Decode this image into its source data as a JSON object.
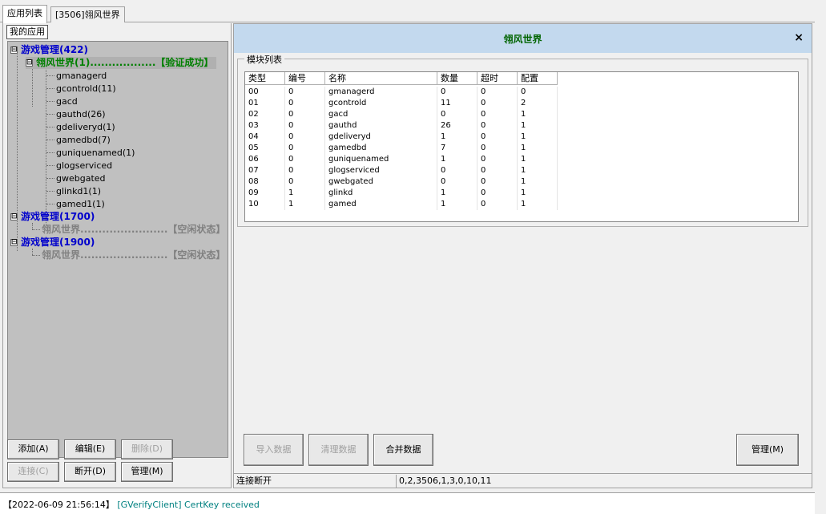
{
  "top_tabs": [
    "应用列表",
    "[3506]翎风世界"
  ],
  "left": {
    "subtab": "我的应用",
    "tree": {
      "group1": {
        "label": "游戏管理(422)",
        "expander": "⊟"
      },
      "game1": {
        "name": "翎风世界(1)",
        "dots": "..................",
        "status": "【验证成功】"
      },
      "modules": [
        "gmanagerd",
        "gcontrold(11)",
        "gacd",
        "gauthd(26)",
        "gdeliveryd(1)",
        "gamedbd(7)",
        "guniquenamed(1)",
        "glogserviced",
        "gwebgated",
        "glinkd1(1)",
        "gamed1(1)"
      ],
      "group2": {
        "label": "游戏管理(1700)",
        "expander": "⊟"
      },
      "game2": {
        "name": "翎风世界",
        "dots": "........................",
        "status": "【空闲状态】"
      },
      "group3": {
        "label": "游戏管理(1900)",
        "expander": "⊟"
      },
      "game3": {
        "name": "翎风世界",
        "dots": "........................",
        "status": "【空闲状态】"
      }
    },
    "buttons": {
      "add": "添加(A)",
      "edit": "编辑(E)",
      "delete": "删除(D)",
      "connect": "连接(C)",
      "disconnect": "断开(D)",
      "manage": "管理(M)"
    }
  },
  "right": {
    "title": "翎风世界",
    "close": "×",
    "groupbox_label": "模块列表",
    "columns": [
      "类型",
      "编号",
      "名称",
      "数量",
      "超时",
      "配置"
    ],
    "rows": [
      [
        "00",
        "0",
        "gmanagerd",
        "0",
        "0",
        "0"
      ],
      [
        "01",
        "0",
        "gcontrold",
        "11",
        "0",
        "2"
      ],
      [
        "02",
        "0",
        "gacd",
        "0",
        "0",
        "1"
      ],
      [
        "03",
        "0",
        "gauthd",
        "26",
        "0",
        "1"
      ],
      [
        "04",
        "0",
        "gdeliveryd",
        "1",
        "0",
        "1"
      ],
      [
        "05",
        "0",
        "gamedbd",
        "7",
        "0",
        "1"
      ],
      [
        "06",
        "0",
        "guniquenamed",
        "1",
        "0",
        "1"
      ],
      [
        "07",
        "0",
        "glogserviced",
        "0",
        "0",
        "1"
      ],
      [
        "08",
        "0",
        "gwebgated",
        "0",
        "0",
        "1"
      ],
      [
        "09",
        "1",
        "glinkd",
        "1",
        "0",
        "1"
      ],
      [
        "10",
        "1",
        "gamed",
        "1",
        "0",
        "1"
      ]
    ],
    "buttons": {
      "import": "导入数据",
      "clear": "清理数据",
      "merge": "合并数据",
      "manage": "管理(M)"
    },
    "status": {
      "connection": "连接断开",
      "info": "0,2,3506,1,3,0,10,11"
    }
  },
  "log": {
    "timestamp": "【2022-06-09 21:56:14】",
    "source": "[GVerifyClient]",
    "message": "CertKey received"
  }
}
